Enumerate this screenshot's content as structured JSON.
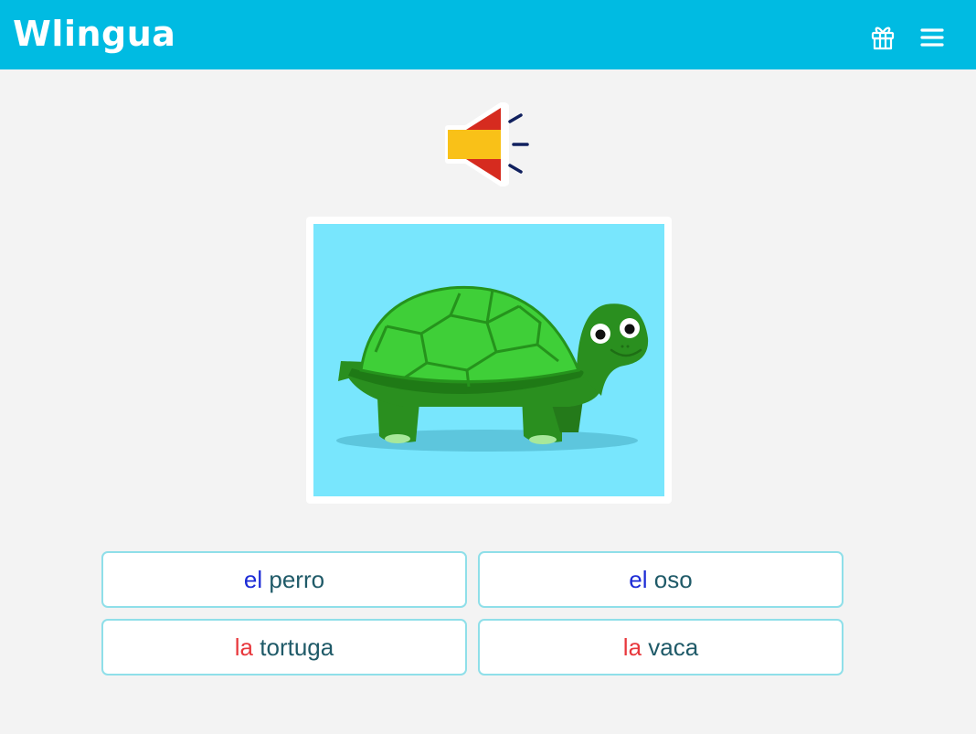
{
  "header": {
    "logo": "Wlingua",
    "gift_icon": "gift-icon",
    "menu_icon": "hamburger-menu-icon",
    "color": "#00bbe2"
  },
  "exercise": {
    "audio_icon": "speaker-spanish-flag-icon",
    "image_subject": "turtle"
  },
  "answers": [
    {
      "article": "el",
      "noun": "perro",
      "gender": "masculine"
    },
    {
      "article": "el",
      "noun": "oso",
      "gender": "masculine"
    },
    {
      "article": "la",
      "noun": "tortuga",
      "gender": "feminine"
    },
    {
      "article": "la",
      "noun": "vaca",
      "gender": "feminine"
    }
  ],
  "colors": {
    "masculine_article": "#1c2bd6",
    "feminine_article": "#e8383d",
    "noun": "#1f5a68",
    "answer_border": "#8fdfe9",
    "picture_bg": "#78e6fd"
  }
}
